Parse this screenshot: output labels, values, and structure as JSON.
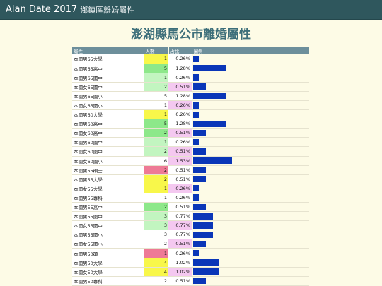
{
  "header": {
    "app_title": "Alan Date 2017",
    "subtitle": "鄉鎮區離婚屬性"
  },
  "page_title": "澎湖縣馬公市離婚屬性",
  "table": {
    "columns": [
      "屬性",
      "人數",
      "占比",
      "圖例"
    ],
    "colors": {
      "yellow": "#f8f74a",
      "green": "#8de88a",
      "lightgreen": "#c2f5c0",
      "pink": "#f4c8f0",
      "red": "#ee7a96",
      "white": "#ffffff",
      "bar": "#0a36b8"
    },
    "rows": [
      {
        "attr": "本國男65大學",
        "count": "1",
        "pct": "0.26%",
        "value": 0.26,
        "count_color": "yellow",
        "pct_color": "white"
      },
      {
        "attr": "本國男65高中",
        "count": "5",
        "pct": "1.28%",
        "value": 1.28,
        "count_color": "green",
        "pct_color": "white"
      },
      {
        "attr": "本國男65國中",
        "count": "1",
        "pct": "0.26%",
        "value": 0.26,
        "count_color": "lightgreen",
        "pct_color": "white"
      },
      {
        "attr": "本國女65國中",
        "count": "2",
        "pct": "0.51%",
        "value": 0.51,
        "count_color": "lightgreen",
        "pct_color": "pink"
      },
      {
        "attr": "本國男65國小",
        "count": "5",
        "pct": "1.28%",
        "value": 1.28,
        "count_color": "white",
        "pct_color": "white"
      },
      {
        "attr": "本國女65國小",
        "count": "1",
        "pct": "0.26%",
        "value": 0.26,
        "count_color": "white",
        "pct_color": "pink"
      },
      {
        "attr": "本國男60大學",
        "count": "1",
        "pct": "0.26%",
        "value": 0.26,
        "count_color": "yellow",
        "pct_color": "white"
      },
      {
        "attr": "本國男60高中",
        "count": "5",
        "pct": "1.28%",
        "value": 1.28,
        "count_color": "green",
        "pct_color": "white"
      },
      {
        "attr": "本國女60高中",
        "count": "2",
        "pct": "0.51%",
        "value": 0.51,
        "count_color": "green",
        "pct_color": "pink"
      },
      {
        "attr": "本國男60國中",
        "count": "1",
        "pct": "0.26%",
        "value": 0.26,
        "count_color": "lightgreen",
        "pct_color": "white"
      },
      {
        "attr": "本國女60國中",
        "count": "2",
        "pct": "0.51%",
        "value": 0.51,
        "count_color": "lightgreen",
        "pct_color": "pink"
      },
      {
        "attr": "本國女60國小",
        "count": "6",
        "pct": "1.53%",
        "value": 1.53,
        "count_color": "white",
        "pct_color": "pink"
      },
      {
        "attr": "本國男55碩士",
        "count": "2",
        "pct": "0.51%",
        "value": 0.51,
        "count_color": "red",
        "pct_color": "white"
      },
      {
        "attr": "本國男55大學",
        "count": "2",
        "pct": "0.51%",
        "value": 0.51,
        "count_color": "yellow",
        "pct_color": "white"
      },
      {
        "attr": "本國女55大學",
        "count": "1",
        "pct": "0.26%",
        "value": 0.26,
        "count_color": "yellow",
        "pct_color": "pink"
      },
      {
        "attr": "本國男55專科",
        "count": "1",
        "pct": "0.26%",
        "value": 0.26,
        "count_color": "white",
        "pct_color": "white"
      },
      {
        "attr": "本國男55高中",
        "count": "2",
        "pct": "0.51%",
        "value": 0.51,
        "count_color": "green",
        "pct_color": "white"
      },
      {
        "attr": "本國男55國中",
        "count": "3",
        "pct": "0.77%",
        "value": 0.77,
        "count_color": "lightgreen",
        "pct_color": "white"
      },
      {
        "attr": "本國女55國中",
        "count": "3",
        "pct": "0.77%",
        "value": 0.77,
        "count_color": "lightgreen",
        "pct_color": "pink"
      },
      {
        "attr": "本國男55國小",
        "count": "3",
        "pct": "0.77%",
        "value": 0.77,
        "count_color": "white",
        "pct_color": "white"
      },
      {
        "attr": "本國女55國小",
        "count": "2",
        "pct": "0.51%",
        "value": 0.51,
        "count_color": "white",
        "pct_color": "pink"
      },
      {
        "attr": "本國男50碩士",
        "count": "1",
        "pct": "0.26%",
        "value": 0.26,
        "count_color": "red",
        "pct_color": "white"
      },
      {
        "attr": "本國男50大學",
        "count": "4",
        "pct": "1.02%",
        "value": 1.02,
        "count_color": "yellow",
        "pct_color": "white"
      },
      {
        "attr": "本國女50大學",
        "count": "4",
        "pct": "1.02%",
        "value": 1.02,
        "count_color": "yellow",
        "pct_color": "pink"
      },
      {
        "attr": "本國男50專科",
        "count": "2",
        "pct": "0.51%",
        "value": 0.51,
        "count_color": "white",
        "pct_color": "white"
      }
    ]
  }
}
